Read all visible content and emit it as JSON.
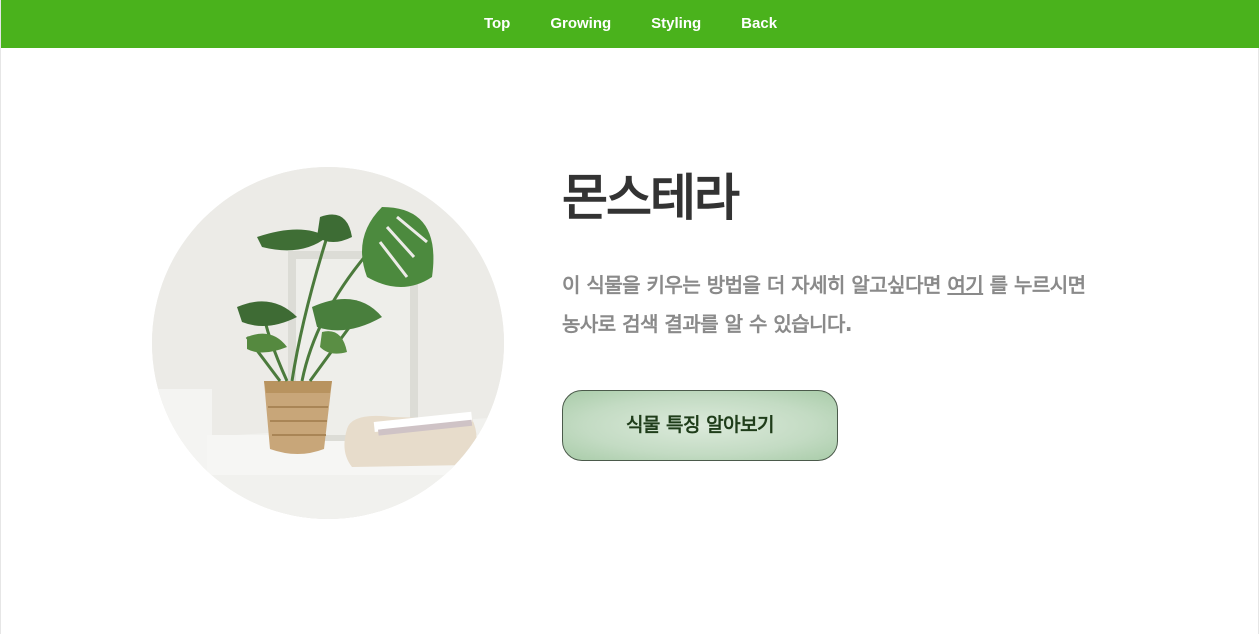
{
  "nav": {
    "items": [
      {
        "label": "Top"
      },
      {
        "label": "Growing"
      },
      {
        "label": "Styling"
      },
      {
        "label": "Back"
      }
    ]
  },
  "hero": {
    "title": "몬스테라",
    "description_before": "이 식물을 키우는 방법을 더 자세히 알고싶다면 ",
    "description_link": "여기",
    "description_after": " 를 누르시면 농사로 검색 결과를 알 수 있습니다.",
    "button_label": "식물 특징 알아보기"
  },
  "colors": {
    "nav_bg": "#4ab21c",
    "title": "#333333",
    "text": "#8a8a8a",
    "button_text": "#1f3d1a"
  },
  "icons": {
    "hero_image": "monstera-plant-photo"
  }
}
